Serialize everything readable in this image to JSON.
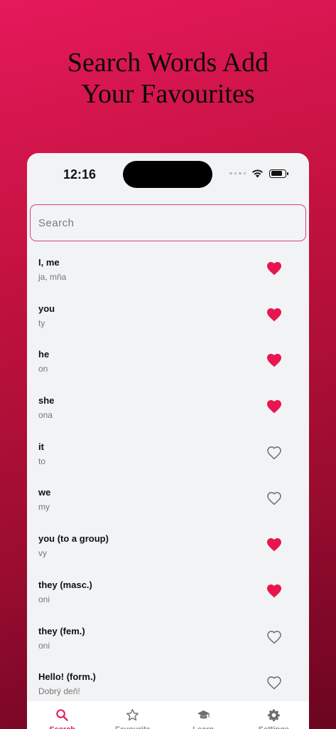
{
  "headline": {
    "line1": "Search Words Add",
    "line2": "Your Favourites"
  },
  "status_bar": {
    "time": "12:16"
  },
  "search": {
    "placeholder": "Search",
    "value": ""
  },
  "colors": {
    "accent": "#e01b55",
    "heart_filled": "#e8164f",
    "heart_outline": "#6a6a6a"
  },
  "words": [
    {
      "en": "I, me",
      "cz": "ja, mňa",
      "favourite": true
    },
    {
      "en": "you",
      "cz": "ty",
      "favourite": true
    },
    {
      "en": "he",
      "cz": "on",
      "favourite": true
    },
    {
      "en": "she",
      "cz": "ona",
      "favourite": true
    },
    {
      "en": "it",
      "cz": "to",
      "favourite": false
    },
    {
      "en": "we",
      "cz": "my",
      "favourite": false
    },
    {
      "en": "you (to a group)",
      "cz": "vy",
      "favourite": true
    },
    {
      "en": "they (masc.)",
      "cz": "oni",
      "favourite": true
    },
    {
      "en": "they (fem.)",
      "cz": "oni",
      "favourite": false
    },
    {
      "en": "Hello! (form.)",
      "cz": "Dobrý deň!",
      "favourite": false
    }
  ],
  "tabs": [
    {
      "label": "Search",
      "icon": "search-icon",
      "active": true
    },
    {
      "label": "Favourite",
      "icon": "star-icon",
      "active": false
    },
    {
      "label": "Learn",
      "icon": "graduation-cap-icon",
      "active": false
    },
    {
      "label": "Settings",
      "icon": "gear-icon",
      "active": false
    }
  ]
}
